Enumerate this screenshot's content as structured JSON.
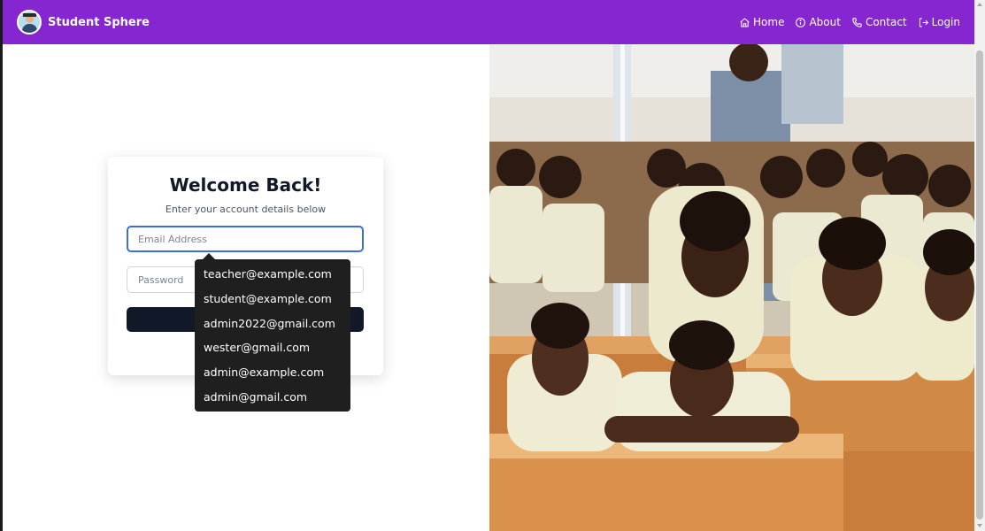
{
  "brand": {
    "name": "Student Sphere",
    "logo_icon": "student-avatar-icon"
  },
  "nav": {
    "items": [
      {
        "label": "Home",
        "icon": "home-icon"
      },
      {
        "label": "About",
        "icon": "info-icon"
      },
      {
        "label": "Contact",
        "icon": "phone-icon"
      },
      {
        "label": "Login",
        "icon": "login-icon"
      }
    ]
  },
  "login": {
    "title": "Welcome Back!",
    "subtitle": "Enter your account details below",
    "email_placeholder": "Email Address",
    "email_value": "",
    "password_placeholder": "Password",
    "password_value": "",
    "button_label": ""
  },
  "autocomplete": {
    "suggestions": [
      "teacher@example.com",
      "student@example.com",
      "admin2022@gmail.com",
      "wester@gmail.com",
      "admin@example.com",
      "admin@gmail.com"
    ]
  },
  "colors": {
    "navbar": "#8526d0",
    "button": "#111827",
    "focus_border": "#3b6fd6",
    "dropdown_bg": "#1f1f1f"
  },
  "hero_image": {
    "subject": "students-in-classroom-photo"
  }
}
